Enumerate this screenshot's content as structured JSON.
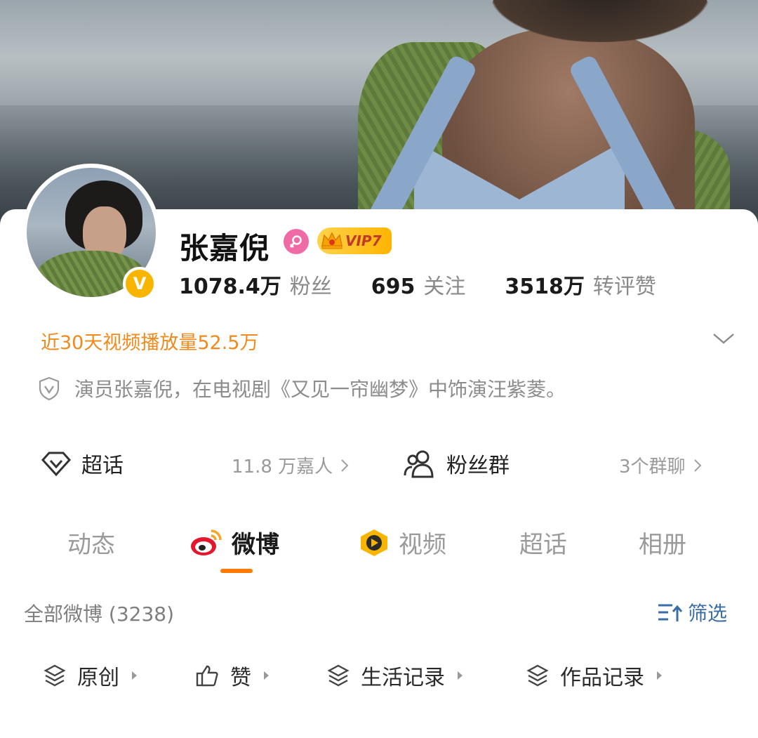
{
  "profile": {
    "name": "张嘉倪",
    "vip_label": "VIP7",
    "verified_mark": "V",
    "stats": [
      {
        "value": "1078.4万",
        "label": "粉丝"
      },
      {
        "value": "695",
        "label": "关注"
      },
      {
        "value": "3518万",
        "label": "转评赞"
      }
    ],
    "highlight": "近30天视频播放量52.5万",
    "bio": "演员张嘉倪，在电视剧《又见一帘幽梦》中饰演汪紫菱。"
  },
  "links": {
    "super_topic": {
      "title": "超话",
      "sub": "11.8 万嘉人",
      "icon": "diamond-icon"
    },
    "fan_group": {
      "title": "粉丝群",
      "sub": "3个群聊",
      "icon": "users-icon"
    }
  },
  "tabs": [
    {
      "label": "动态",
      "active": false
    },
    {
      "label": "微博",
      "active": true,
      "icon": "weibo-logo-icon"
    },
    {
      "label": "视频",
      "active": false,
      "icon": "video-play-icon"
    },
    {
      "label": "超话",
      "active": false
    },
    {
      "label": "相册",
      "active": false
    }
  ],
  "feed": {
    "section_title": "全部微博 (3238)",
    "filter_label": "筛选",
    "chips": [
      {
        "label": "原创",
        "icon": "layers-icon"
      },
      {
        "label": "赞",
        "icon": "thumbs-up-icon"
      },
      {
        "label": "生活记录",
        "icon": "layers-icon"
      },
      {
        "label": "作品记录",
        "icon": "layers-icon"
      }
    ]
  },
  "colors": {
    "accent_orange": "#ff7a00",
    "highlight_orange": "#f08a1c",
    "filter_blue": "#3c6ea6",
    "verified_gold": "#f7b500",
    "female_pink": "#f06aa6"
  }
}
